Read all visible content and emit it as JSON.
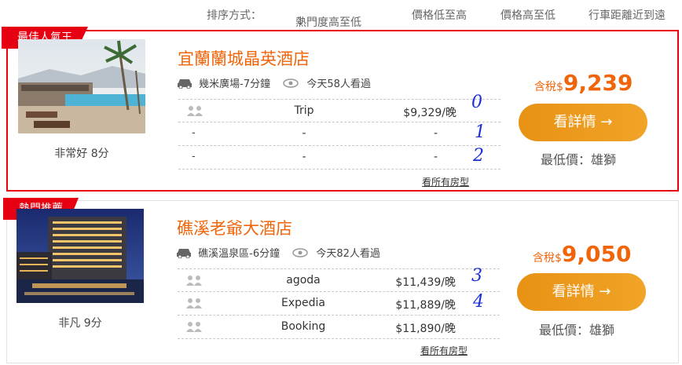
{
  "sort": {
    "label": "排序方式：",
    "active": "熱門度高至低",
    "options": [
      "價格低至高",
      "價格高至低",
      "行車距離近到遠"
    ]
  },
  "hotels": [
    {
      "badge": "最佳人氣王",
      "name": "宜蘭蘭城晶英酒店",
      "rating": "非常好 8分",
      "location": "幾米廣場-7分鐘",
      "views": "今天58人看過",
      "offers": [
        {
          "site": "Trip",
          "price": "$9,329/晚"
        },
        {
          "site": "-",
          "price": "-"
        },
        {
          "site": "-",
          "price": "-"
        }
      ],
      "all_rooms": "看所有房型",
      "tax_prefix": "含稅$",
      "tax_amount": "9,239",
      "detail_button": "看詳情 →",
      "lowest": "最低價：雄獅"
    },
    {
      "badge": "熱門推薦",
      "name": "礁溪老爺大酒店",
      "rating": "非凡 9分",
      "location": "礁溪溫泉區-6分鐘",
      "views": "今天82人看過",
      "offers": [
        {
          "site": "agoda",
          "price": "$11,439/晚"
        },
        {
          "site": "Expedia",
          "price": "$11,889/晚"
        },
        {
          "site": "Booking",
          "price": "$11,890/晚"
        }
      ],
      "all_rooms": "看所有房型",
      "tax_prefix": "含稅$",
      "tax_amount": "9,050",
      "detail_button": "看詳情 →",
      "lowest": "最低價：雄獅"
    }
  ],
  "annotations": [
    "0",
    "1",
    "2",
    "3",
    "4"
  ],
  "colors": {
    "accent": "#f0650a",
    "badge": "#e60012",
    "button": "#f0a428",
    "annotation": "#1a2fd6"
  }
}
